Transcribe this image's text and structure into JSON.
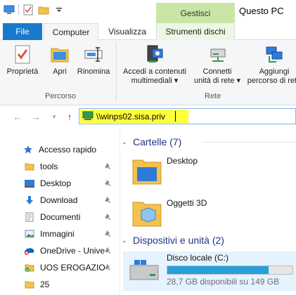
{
  "window": {
    "title": "Questo PC",
    "context_tab_header": "Gestisci"
  },
  "tabs": {
    "file": "File",
    "computer": "Computer",
    "view": "Visualizza",
    "drive_tools": "Strumenti dischi"
  },
  "ribbon": {
    "groups": {
      "location": {
        "label": "Percorso",
        "buttons": {
          "properties": "Proprietà",
          "open": "Apri",
          "rename": "Rinomina"
        }
      },
      "network": {
        "label": "Rete",
        "buttons": {
          "media_line1": "Accedi a contenuti",
          "media_line2": "multimediali ▾",
          "map_line1": "Connetti",
          "map_line2": "unità di rete ▾",
          "add_line1": "Aggiungi",
          "add_line2": "percorso di rete"
        }
      }
    }
  },
  "address": {
    "value": "\\\\winps02.sisa.priv"
  },
  "nav": {
    "quick_access": "Accesso rapido",
    "items": [
      {
        "label": "tools",
        "icon": "folder-icon",
        "pinned": true
      },
      {
        "label": "Desktop",
        "icon": "desktop-icon",
        "pinned": true
      },
      {
        "label": "Download",
        "icon": "download-icon",
        "pinned": true
      },
      {
        "label": "Documenti",
        "icon": "documents-icon",
        "pinned": true
      },
      {
        "label": "Immagini",
        "icon": "pictures-icon",
        "pinned": true
      },
      {
        "label": "OneDrive - Unive",
        "icon": "onedrive-icon",
        "pinned": true
      },
      {
        "label": "UOS EROGAZIONE",
        "icon": "folder-sync-icon",
        "pinned": true
      },
      {
        "label": "25",
        "icon": "folder-icon",
        "pinned": false
      }
    ]
  },
  "content": {
    "folders_header": "Cartelle (7)",
    "folders": [
      {
        "label": "Desktop"
      },
      {
        "label": "Oggetti 3D"
      }
    ],
    "devices_header": "Dispositivi e unità (2)",
    "drive": {
      "label": "Disco locale (C:)",
      "info": "28,7 GB disponibili su 149 GB",
      "used_fraction": 0.81
    }
  },
  "colors": {
    "accent": "#1979ca",
    "highlight": "#ffff3a",
    "context": "#c9e6a6",
    "bar": "#26a0da"
  }
}
